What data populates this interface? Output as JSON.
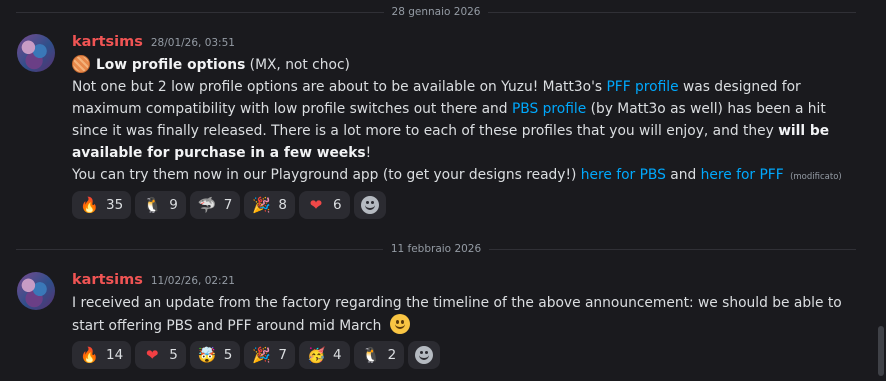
{
  "dividers": [
    {
      "label": "28 gennaio 2026"
    },
    {
      "label": "11 febbraio 2026"
    }
  ],
  "messages": [
    {
      "author": "kartsims",
      "timestamp": "28/01/26, 03:51",
      "title_bold": "Low profile options",
      "title_rest": " (MX, not choc)",
      "p1_a": "Not one but 2 low profile options are about to be available on Yuzu! Matt3o's ",
      "p1_link1": "PFF profile",
      "p1_b": " was designed for maximum compatibility with low profile switches out there and ",
      "p1_link2": "PBS profile",
      "p1_c": " (by Matt3o as well) has been a hit since it was finally released. There is a lot more to each of these profiles that you will enjoy, and they ",
      "p1_bold": "will be available for purchase in a few weeks",
      "p1_d": "!",
      "p2_a": "You can try them now in our Playground app (to get your designs ready!) ",
      "p2_link1": "here for PBS",
      "p2_b": " and ",
      "p2_link2": "here for PFF",
      "edited": "(modificato)",
      "reactions": [
        {
          "emoji": "🔥",
          "icon": "fire-icon",
          "count": "35"
        },
        {
          "emoji": "🐧",
          "icon": "penguin-icon",
          "count": "9"
        },
        {
          "emoji": "🦈",
          "icon": "shark-icon",
          "count": "7"
        },
        {
          "emoji": "🎉",
          "icon": "party-popper-icon",
          "count": "8"
        },
        {
          "emoji": "❤",
          "icon": "heart-on-fire-icon",
          "count": "6"
        }
      ]
    },
    {
      "author": "kartsims",
      "timestamp": "11/02/26, 02:21",
      "text": "I received an update from the factory regarding the timeline of the above announcement: we should be able to start offering PBS and PFF around mid March ",
      "reactions": [
        {
          "emoji": "🔥",
          "icon": "fire-icon",
          "count": "14"
        },
        {
          "emoji": "❤",
          "icon": "heart-icon",
          "count": "5"
        },
        {
          "emoji": "🤯",
          "icon": "exploding-head-icon",
          "count": "5"
        },
        {
          "emoji": "🎉",
          "icon": "party-popper-icon",
          "count": "7"
        },
        {
          "emoji": "🥳",
          "icon": "partying-face-icon",
          "count": "4"
        },
        {
          "emoji": "🐧",
          "icon": "penguin-icon",
          "count": "2"
        }
      ]
    }
  ]
}
